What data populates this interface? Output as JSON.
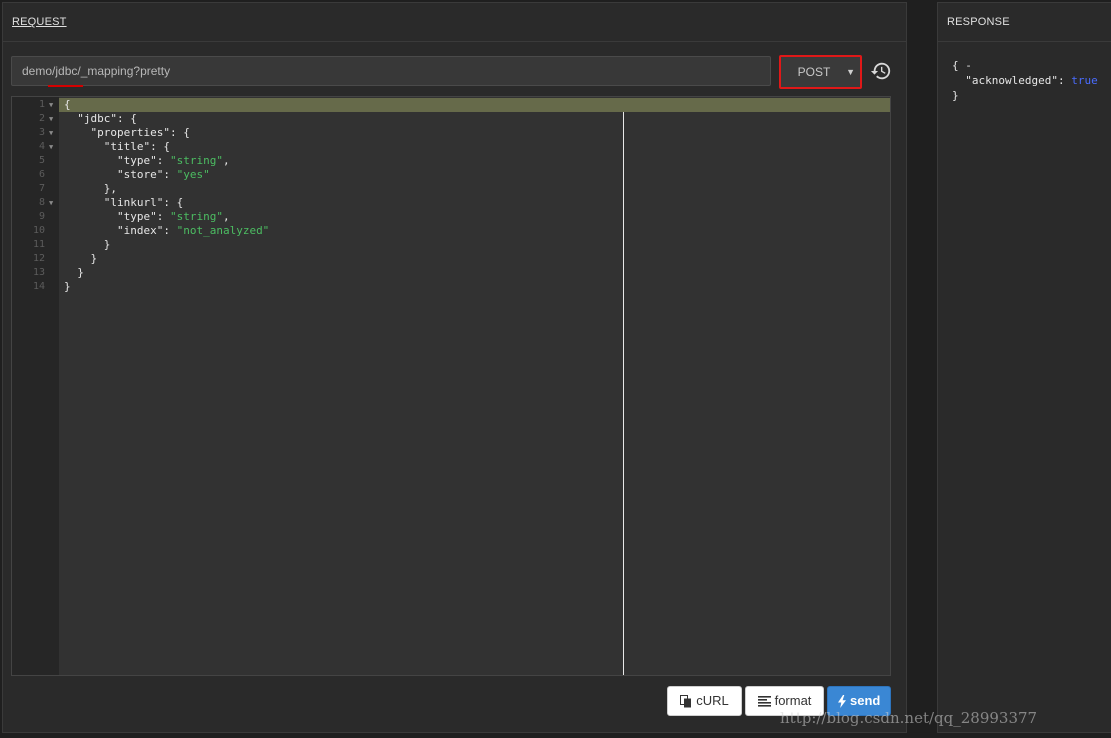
{
  "request": {
    "header": "REQUEST",
    "url_value": "demo/jdbc/_mapping?pretty",
    "method": "POST",
    "history_icon": "history-icon",
    "editor_lines": [
      {
        "n": "1",
        "fold": true,
        "parts": [
          {
            "t": "{"
          }
        ]
      },
      {
        "n": "2",
        "fold": true,
        "parts": [
          {
            "t": "  \"jdbc\": {"
          }
        ]
      },
      {
        "n": "3",
        "fold": true,
        "parts": [
          {
            "t": "    \"properties\": {"
          }
        ]
      },
      {
        "n": "4",
        "fold": true,
        "parts": [
          {
            "t": "      \"title\": {"
          }
        ]
      },
      {
        "n": "5",
        "fold": false,
        "parts": [
          {
            "t": "        \"type\": "
          },
          {
            "t": "\"string\"",
            "c": "str"
          },
          {
            "t": ","
          }
        ]
      },
      {
        "n": "6",
        "fold": false,
        "parts": [
          {
            "t": "        \"store\": "
          },
          {
            "t": "\"yes\"",
            "c": "str"
          }
        ]
      },
      {
        "n": "7",
        "fold": false,
        "parts": [
          {
            "t": "      },"
          }
        ]
      },
      {
        "n": "8",
        "fold": true,
        "parts": [
          {
            "t": "      \"linkurl\": {"
          }
        ]
      },
      {
        "n": "9",
        "fold": false,
        "parts": [
          {
            "t": "        \"type\": "
          },
          {
            "t": "\"string\"",
            "c": "str"
          },
          {
            "t": ","
          }
        ]
      },
      {
        "n": "10",
        "fold": false,
        "parts": [
          {
            "t": "        \"index\": "
          },
          {
            "t": "\"not_analyzed\"",
            "c": "str"
          }
        ]
      },
      {
        "n": "11",
        "fold": false,
        "parts": [
          {
            "t": "      }"
          }
        ]
      },
      {
        "n": "12",
        "fold": false,
        "parts": [
          {
            "t": "    }"
          }
        ]
      },
      {
        "n": "13",
        "fold": false,
        "parts": [
          {
            "t": "  }"
          }
        ]
      },
      {
        "n": "14",
        "fold": false,
        "parts": [
          {
            "t": "}"
          }
        ]
      }
    ],
    "buttons": {
      "curl": "cURL",
      "format": "format",
      "send": "send"
    }
  },
  "response": {
    "header": "RESPONSE",
    "body": [
      {
        "parts": [
          {
            "t": "{ -"
          }
        ]
      },
      {
        "parts": [
          {
            "t": "  \"acknowledged\": "
          },
          {
            "t": "true",
            "c": "bool"
          }
        ]
      },
      {
        "parts": [
          {
            "t": "}"
          }
        ]
      }
    ]
  },
  "watermark": "http://blog.csdn.net/qq_28993377",
  "colors": {
    "accent_red": "#e01818",
    "send_blue": "#3a87d4",
    "string_green": "#4cbd62",
    "bool_blue": "#4a6cff",
    "active_line": "#666a4a"
  }
}
